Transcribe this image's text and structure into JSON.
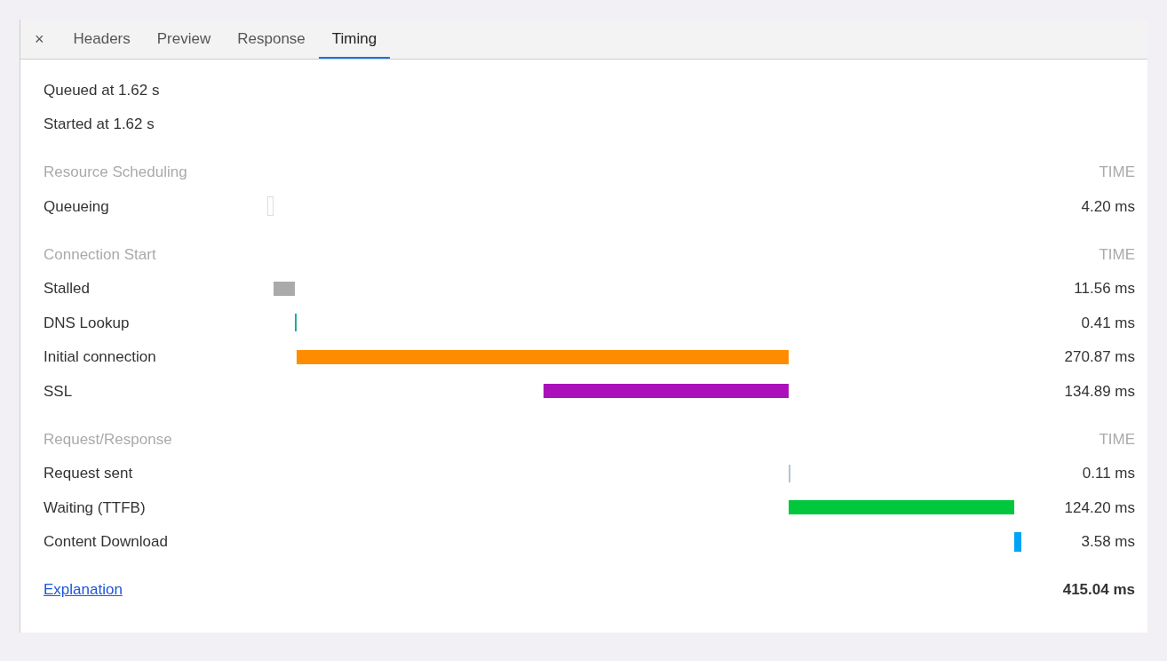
{
  "tabs": [
    {
      "label": "Headers",
      "selected": false
    },
    {
      "label": "Preview",
      "selected": false
    },
    {
      "label": "Response",
      "selected": false
    },
    {
      "label": "Timing",
      "selected": true
    }
  ],
  "close": "×",
  "queued": "Queued at 1.62 s",
  "started": "Started at 1.62 s",
  "sections": [
    {
      "title": "Resource Scheduling",
      "time_header": "TIME",
      "rows": [
        {
          "label": "Queueing",
          "time": "4.20 ms",
          "kind": "outline"
        }
      ]
    },
    {
      "title": "Connection Start",
      "time_header": "TIME",
      "rows": [
        {
          "label": "Stalled",
          "time": "11.56 ms",
          "kind": "bar",
          "color": "#aaaaaa"
        },
        {
          "label": "DNS Lookup",
          "time": "0.41 ms",
          "kind": "line",
          "color": "#1faa99"
        },
        {
          "label": "Initial connection",
          "time": "270.87 ms",
          "kind": "bar",
          "color": "#ff8c00"
        },
        {
          "label": "SSL",
          "time": "134.89 ms",
          "kind": "bar",
          "color": "#aa11bb"
        }
      ]
    },
    {
      "title": "Request/Response",
      "time_header": "TIME",
      "rows": [
        {
          "label": "Request sent",
          "time": "0.11 ms",
          "kind": "line",
          "color": "#b0c4d4"
        },
        {
          "label": "Waiting (TTFB)",
          "time": "124.20 ms",
          "kind": "bar",
          "color": "#00c73c"
        },
        {
          "label": "Content Download",
          "time": "3.58 ms",
          "kind": "tall",
          "color": "#00a3f5"
        }
      ]
    }
  ],
  "explanation": "Explanation",
  "total": "415.04 ms"
}
